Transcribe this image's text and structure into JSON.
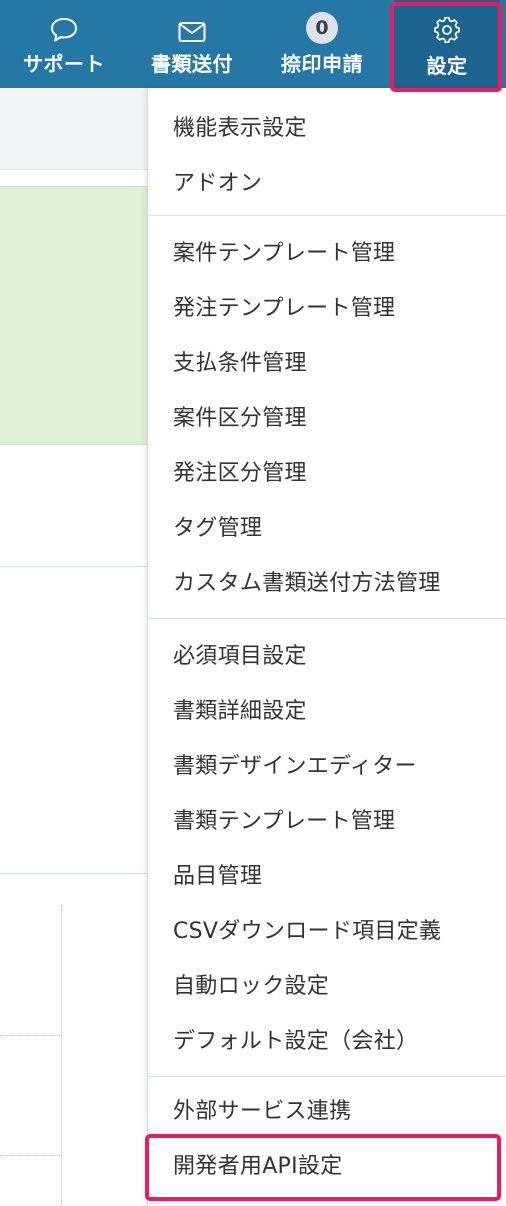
{
  "nav": {
    "support_label": "サポート",
    "docs_label": "書類送付",
    "seal_label": "捺印申請",
    "seal_badge": "0",
    "settings_label": "設定"
  },
  "settings_menu": {
    "group1": [
      "機能表示設定",
      "アドオン"
    ],
    "group2": [
      "案件テンプレート管理",
      "発注テンプレート管理",
      "支払条件管理",
      "案件区分管理",
      "発注区分管理",
      "タグ管理",
      "カスタム書類送付方法管理"
    ],
    "group3": [
      "必須項目設定",
      "書類詳細設定",
      "書類デザインエディター",
      "書類テンプレート管理",
      "品目管理",
      "CSVダウンロード項目定義",
      "自動ロック設定",
      "デフォルト設定（会社）"
    ],
    "group4": [
      "外部サービス連携",
      "開発者用API設定"
    ]
  },
  "colors": {
    "header": "#2577a6",
    "highlight": "#eb1b63",
    "badge": "#dde3e8"
  }
}
